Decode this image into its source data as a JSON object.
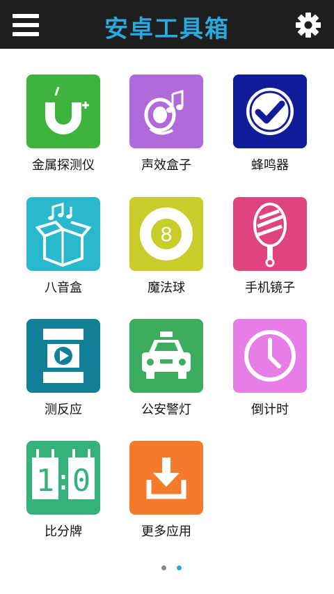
{
  "header": {
    "title": "安卓工具箱",
    "menu_icon": "menu-icon",
    "settings_icon": "gear-icon"
  },
  "tools": [
    {
      "label": "金属探测仪",
      "icon": "magnet-icon",
      "color": "#3db33d"
    },
    {
      "label": "声效盒子",
      "icon": "speaker-music-icon",
      "color": "#b06ad9"
    },
    {
      "label": "蜂鸣器",
      "icon": "check-circle-icon",
      "color": "#111c9a"
    },
    {
      "label": "八音盒",
      "icon": "music-box-icon",
      "color": "#2ab8cc"
    },
    {
      "label": "魔法球",
      "icon": "eight-ball-icon",
      "color": "#c9cd2a"
    },
    {
      "label": "手机镜子",
      "icon": "hand-mirror-icon",
      "color": "#e0447d"
    },
    {
      "label": "测反应",
      "icon": "film-play-icon",
      "color": "#117f97"
    },
    {
      "label": "公安警灯",
      "icon": "taxi-icon",
      "color": "#3aae5e"
    },
    {
      "label": "倒计时",
      "icon": "clock-icon",
      "color": "#e77de6"
    },
    {
      "label": "比分牌",
      "icon": "scoreboard-icon",
      "color": "#34b27a"
    },
    {
      "label": "更多应用",
      "icon": "download-icon",
      "color": "#f47a2c"
    }
  ],
  "scoreboard_text": {
    "left": "1",
    "colon": ":",
    "right": "0"
  },
  "eight_ball_number": "8",
  "pager": {
    "pages": 2,
    "current": 2,
    "active_color": "#2aa9e0",
    "inactive_color": "#888888"
  }
}
